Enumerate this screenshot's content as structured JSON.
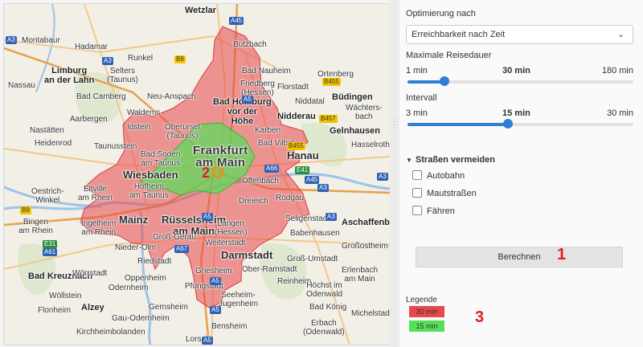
{
  "map": {
    "cities": [
      {
        "name": "Wetzlar",
        "cls": "c-md"
      },
      {
        "name": "Montabaur",
        "cls": "c-sm"
      },
      {
        "name": "Hadamar",
        "cls": "c-sm"
      },
      {
        "name": "Limburg\nan der Lahn",
        "cls": "c-md"
      },
      {
        "name": "Nassau",
        "cls": "c-sm"
      },
      {
        "name": "Runkel",
        "cls": "c-sm"
      },
      {
        "name": "Selters\n(Taunus)",
        "cls": "c-sm"
      },
      {
        "name": "Neu-Anspach",
        "cls": "c-sm"
      },
      {
        "name": "Bad Camberg",
        "cls": "c-sm"
      },
      {
        "name": "Waldems",
        "cls": "c-sm"
      },
      {
        "name": "Aarbergen",
        "cls": "c-sm"
      },
      {
        "name": "Idstein",
        "cls": "c-sm"
      },
      {
        "name": "Oberursel\n(Taunus)",
        "cls": "c-sm"
      },
      {
        "name": "Nastätten",
        "cls": "c-sm"
      },
      {
        "name": "Heidenrod",
        "cls": "c-sm"
      },
      {
        "name": "Taunusstein",
        "cls": "c-sm"
      },
      {
        "name": "Bad Soden\nam Taunus",
        "cls": "c-sm"
      },
      {
        "name": "Wiesbaden",
        "cls": "c-lg"
      },
      {
        "name": "Hofheim\nam Taunus",
        "cls": "c-sm"
      },
      {
        "name": "Eltville\nam Rhein",
        "cls": "c-sm"
      },
      {
        "name": "Oestrich-\nWinkel",
        "cls": "c-sm"
      },
      {
        "name": "Mainz",
        "cls": "c-lg"
      },
      {
        "name": "Ingelheim\nam Rhein",
        "cls": "c-sm"
      },
      {
        "name": "Bingen\nam Rhein",
        "cls": "c-sm"
      },
      {
        "name": "Rüsselsheim\nam Main",
        "cls": "c-lg"
      },
      {
        "name": "Groß-Gerau",
        "cls": "c-sm"
      },
      {
        "name": "Nieder-Olm",
        "cls": "c-sm"
      },
      {
        "name": "Bad Kreuznach",
        "cls": "c-md"
      },
      {
        "name": "Riedstadt",
        "cls": "c-sm"
      },
      {
        "name": "Wörrstadt",
        "cls": "c-sm"
      },
      {
        "name": "Oppenheim",
        "cls": "c-sm"
      },
      {
        "name": "Odernheim",
        "cls": "c-sm"
      },
      {
        "name": "Wöllstein",
        "cls": "c-sm"
      },
      {
        "name": "Alzey",
        "cls": "c-md"
      },
      {
        "name": "Flonheim",
        "cls": "c-sm"
      },
      {
        "name": "Gau-Odernheim",
        "cls": "c-sm"
      },
      {
        "name": "Kirchheimbolanden",
        "cls": "c-sm"
      },
      {
        "name": "Butzbach",
        "cls": "c-sm"
      },
      {
        "name": "Bad Nauheim",
        "cls": "c-sm"
      },
      {
        "name": "Friedberg\n(Hessen)",
        "cls": "c-sm"
      },
      {
        "name": "Florstadt",
        "cls": "c-sm"
      },
      {
        "name": "Ortenberg",
        "cls": "c-sm"
      },
      {
        "name": "Büdingen",
        "cls": "c-md"
      },
      {
        "name": "Bad Homburg\nvor der\nHöhe",
        "cls": "c-md"
      },
      {
        "name": "Niddatal",
        "cls": "c-sm"
      },
      {
        "name": "Nidderau",
        "cls": "c-md"
      },
      {
        "name": "Wächters-\nbach",
        "cls": "c-sm"
      },
      {
        "name": "Karben",
        "cls": "c-sm"
      },
      {
        "name": "Gelnhausen",
        "cls": "c-md"
      },
      {
        "name": "Hasselroth",
        "cls": "c-sm"
      },
      {
        "name": "Bad Vilbel",
        "cls": "c-sm"
      },
      {
        "name": "Frankfurt\nam Main",
        "cls": "c-xl"
      },
      {
        "name": "Hanau",
        "cls": "c-lg"
      },
      {
        "name": "Offenbach",
        "cls": "c-sm"
      },
      {
        "name": "Dreieich",
        "cls": "c-sm"
      },
      {
        "name": "Rodgau",
        "cls": "c-sm"
      },
      {
        "name": "Langen\n(Hessen)",
        "cls": "c-sm"
      },
      {
        "name": "Seligenstadt",
        "cls": "c-sm"
      },
      {
        "name": "Aschaffenb",
        "cls": "c-md"
      },
      {
        "name": "Babenhausen",
        "cls": "c-sm"
      },
      {
        "name": "Weiterstadt",
        "cls": "c-sm"
      },
      {
        "name": "Darmstadt",
        "cls": "c-lg"
      },
      {
        "name": "Groß-Umstadt",
        "cls": "c-sm"
      },
      {
        "name": "Großostheim",
        "cls": "c-sm"
      },
      {
        "name": "Griesheim",
        "cls": "c-sm"
      },
      {
        "name": "Ober-Ramstadt",
        "cls": "c-sm"
      },
      {
        "name": "Erlenbach\nam Main",
        "cls": "c-sm"
      },
      {
        "name": "Reinheim",
        "cls": "c-sm"
      },
      {
        "name": "Pfungstadt",
        "cls": "c-sm"
      },
      {
        "name": "Höchst im\nOdenwald",
        "cls": "c-sm"
      },
      {
        "name": "Seeheim-\nJugenheim",
        "cls": "c-sm"
      },
      {
        "name": "Gernsheim",
        "cls": "c-sm"
      },
      {
        "name": "Bad König",
        "cls": "c-sm"
      },
      {
        "name": "Michelstadt",
        "cls": "c-sm"
      },
      {
        "name": "Bensheim",
        "cls": "c-sm"
      },
      {
        "name": "Erbach\n(Odenwald)",
        "cls": "c-sm"
      },
      {
        "name": "Lorsch",
        "cls": "c-sm"
      }
    ],
    "shields": [
      "A3",
      "A3",
      "A45",
      "A5",
      "B8",
      "B455",
      "B457",
      "B455",
      "A66",
      "A3",
      "A45",
      "E41",
      "A3",
      "A3",
      "A5",
      "A67",
      "A5",
      "B9",
      "A61",
      "E31",
      "A5",
      "A5"
    ],
    "markers": {
      "calc_marker": "1",
      "origin_marker": "2",
      "legend_marker": "3"
    }
  },
  "panel": {
    "optimize_label": "Optimierung nach",
    "optimize_value": "Erreichbarkeit nach Zeit",
    "max_label": "Maximale Reisedauer",
    "max_min": "1 min",
    "max_value": "30 min",
    "max_max": "180 min",
    "max_level": 0.162,
    "interval_label": "Intervall",
    "int_min": "3 min",
    "int_value": "15 min",
    "int_max": "30 min",
    "int_level": 0.444,
    "avoid_label": "Straßen vermeiden",
    "avoid_options": [
      "Autobahn",
      "Mautstraßen",
      "Fähren"
    ],
    "calc_label": "Berechnen",
    "legend_label": "Legende",
    "legend_items": [
      {
        "label": "30 min",
        "color": "#e8474c"
      },
      {
        "label": "15 min",
        "color": "#55e05a"
      }
    ]
  }
}
